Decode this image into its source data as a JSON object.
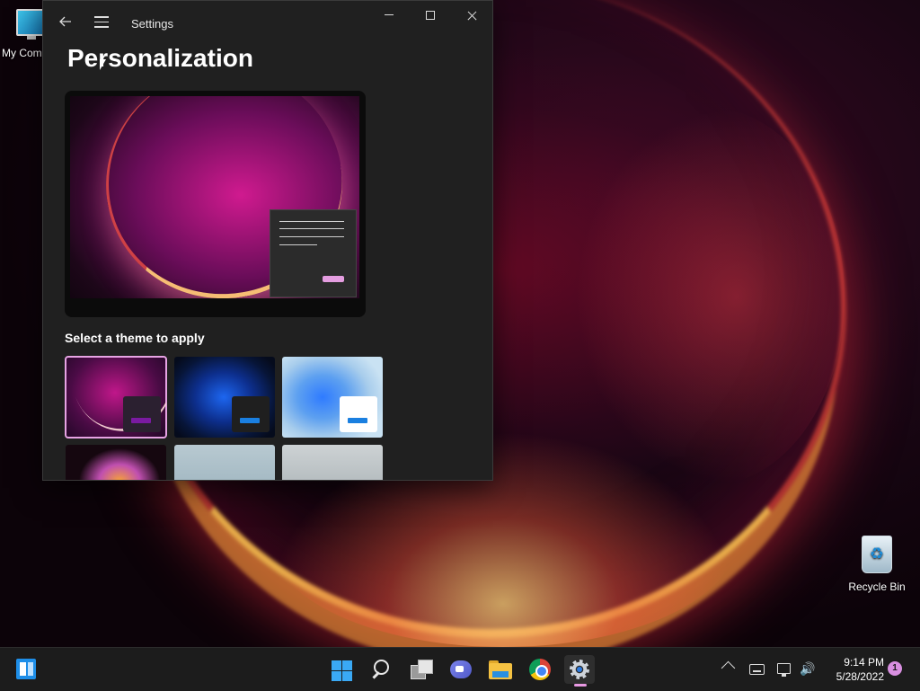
{
  "desktop": {
    "icons": [
      {
        "label": "My Com"
      },
      {
        "label": "Recycle Bin"
      }
    ]
  },
  "window": {
    "app_title": "Settings",
    "page_title": "Personalization",
    "section_label": "Select a theme to apply",
    "themes": [
      {
        "name": "glow",
        "selected": true
      },
      {
        "name": "bloom-dark",
        "selected": false
      },
      {
        "name": "bloom-light",
        "selected": false
      },
      {
        "name": "flower",
        "selected": false
      },
      {
        "name": "grey-1",
        "selected": false
      },
      {
        "name": "grey-2",
        "selected": false
      }
    ],
    "accent_color": "#e7a3e4"
  },
  "taskbar": {
    "apps": [
      "widgets-icon",
      "start-icon",
      "search-icon",
      "task-view-icon",
      "chat-icon",
      "file-explorer-icon",
      "chrome-icon",
      "settings-icon"
    ],
    "active_app": "settings-icon",
    "clock": {
      "time": "9:14 PM",
      "date": "5/28/2022"
    },
    "notification_count": "1"
  }
}
